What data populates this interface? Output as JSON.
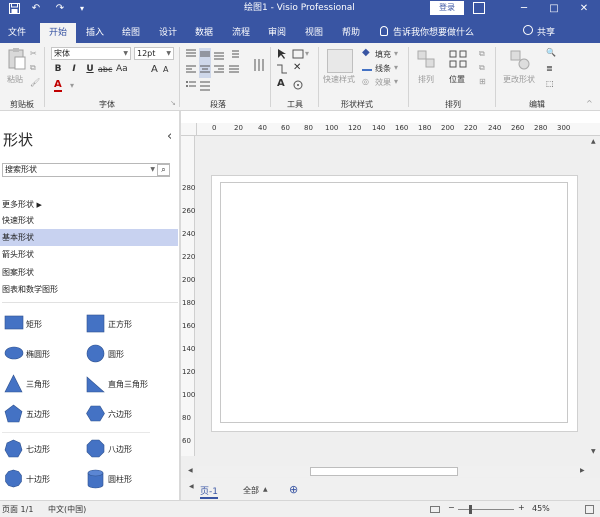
{
  "window": {
    "title": "绘图1 - Visio Professional",
    "login_label": "登录",
    "minimize": "─",
    "restore": "□",
    "close": "✕",
    "save_icon": "floppy-icon",
    "undo_icon": "↶",
    "redo_icon": "↷",
    "qat_more": "▾"
  },
  "tabs": [
    "文件",
    "开始",
    "插入",
    "绘图",
    "设计",
    "数据",
    "流程",
    "审阅",
    "视图",
    "帮助"
  ],
  "tell_me": "告诉我你想要做什么",
  "share_label": "共享",
  "ribbon": {
    "clipboard": {
      "paste": "粘贴",
      "label": "剪贴板"
    },
    "font": {
      "family": "宋体",
      "size": "12pt",
      "grow": "A",
      "shrink": "A",
      "bold": "B",
      "italic": "I",
      "underline": "U",
      "strike": "abc",
      "case": "Aa",
      "color": "A",
      "label": "字体"
    },
    "paragraph": {
      "label": "段落"
    },
    "tools": {
      "label": "工具"
    },
    "shape_styles": {
      "quick": "快速样式",
      "fill": "填充",
      "line": "线条",
      "effects": "效果",
      "label": "形状样式"
    },
    "arrange": {
      "arrange": "排列",
      "position": "位置",
      "label": "排列"
    },
    "edit": {
      "change_shape": "更改形状",
      "label": "编辑"
    }
  },
  "shapes_panel": {
    "title": "形状",
    "collapse": "‹",
    "search_placeholder": "搜索形状",
    "more_shapes": "更多形状",
    "stencils": [
      "快速形状",
      "基本形状",
      "箭头形状",
      "图案形状",
      "图表和数学图形"
    ],
    "shapes": [
      {
        "name": "矩形",
        "icon": "rectangle-icon"
      },
      {
        "name": "正方形",
        "icon": "square-icon"
      },
      {
        "name": "椭圆形",
        "icon": "ellipse-icon"
      },
      {
        "name": "圆形",
        "icon": "circle-icon"
      },
      {
        "name": "三角形",
        "icon": "triangle-icon"
      },
      {
        "name": "直角三角形",
        "icon": "right-triangle-icon"
      },
      {
        "name": "五边形",
        "icon": "pentagon-icon"
      },
      {
        "name": "六边形",
        "icon": "hexagon-icon"
      },
      {
        "name": "七边形",
        "icon": "heptagon-icon"
      },
      {
        "name": "八边形",
        "icon": "octagon-icon"
      },
      {
        "name": "十边形",
        "icon": "decagon-icon"
      },
      {
        "name": "圆柱形",
        "icon": "cylinder-icon"
      }
    ],
    "shape_color": "#4472c4"
  },
  "rulers": {
    "h_ticks": [
      "0",
      "20",
      "40",
      "60",
      "80",
      "100",
      "120",
      "140",
      "160",
      "180",
      "200",
      "220",
      "240",
      "260",
      "280",
      "300"
    ],
    "v_ticks": [
      "280",
      "260",
      "240",
      "220",
      "200",
      "180",
      "160",
      "140",
      "120",
      "100",
      "80",
      "60",
      "40",
      "20",
      "0"
    ]
  },
  "page_tabs": {
    "page": "页-1",
    "all": "全部",
    "add": "⊕"
  },
  "status": {
    "page": "页面 1/1",
    "lang": "中文(中国)",
    "zoom": "45%"
  },
  "colors": {
    "brand": "#3955a3",
    "accent": "#4472c4",
    "selected": "#c8d2f0"
  }
}
